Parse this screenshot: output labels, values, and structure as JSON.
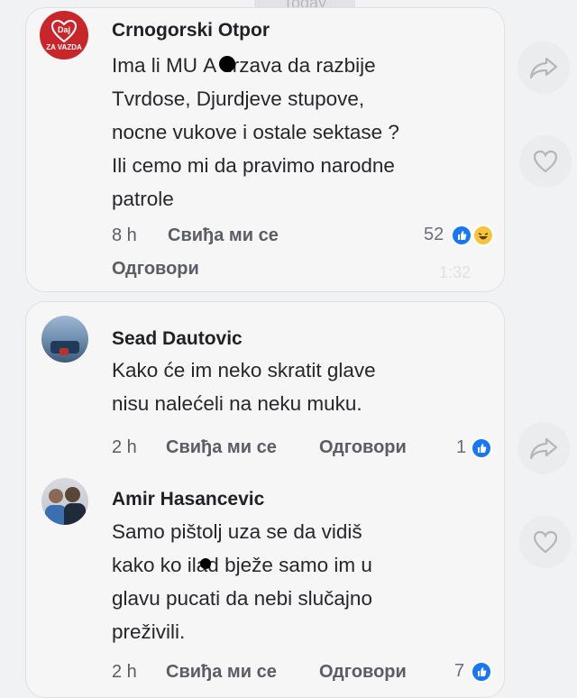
{
  "day_divider": "Today",
  "comments": [
    {
      "author": "Crnogorski Otpor",
      "avatar_text_top": "Daj",
      "avatar_text_bottom": "ZA VAZDA",
      "text": "Ima li MU A drzava da razbije\nTvrdose, Djurdjeve stupove,\nnocne vukove i ostale sektase ?\nIli cemo mi da pravimo narodne\npatrole",
      "time": "8 h",
      "like_label": "Свиђа ми се",
      "reply_label": "Одговори",
      "reaction_count": "52",
      "timestamp": "1:32"
    },
    {
      "author": "Sead Dautovic",
      "text": "Kako će im neko skratit glave\nnisu nalećeli na neku muku.",
      "time": "2 h",
      "like_label": "Свиђа ми се",
      "reply_label": "Одговори",
      "reaction_count": "1"
    },
    {
      "author": "Amir Hasancevic",
      "text": "Samo pištolj uza se da vidiš\nkako ko ilad bježe samo im u\nglavu pucati da nebi slučajno\npreživili.",
      "time": "2 h",
      "like_label": "Свиђа ми се",
      "reply_label": "Одговори",
      "reaction_count": "7"
    }
  ],
  "icons": {
    "share": "share-arrow-icon",
    "like": "heart-icon",
    "reaction_like": "like-reaction-icon",
    "reaction_haha": "haha-reaction-icon"
  },
  "colors": {
    "avatar_red": "#c8262a",
    "like_blue": "#1877f2",
    "haha_yellow": "#f7c53c"
  }
}
